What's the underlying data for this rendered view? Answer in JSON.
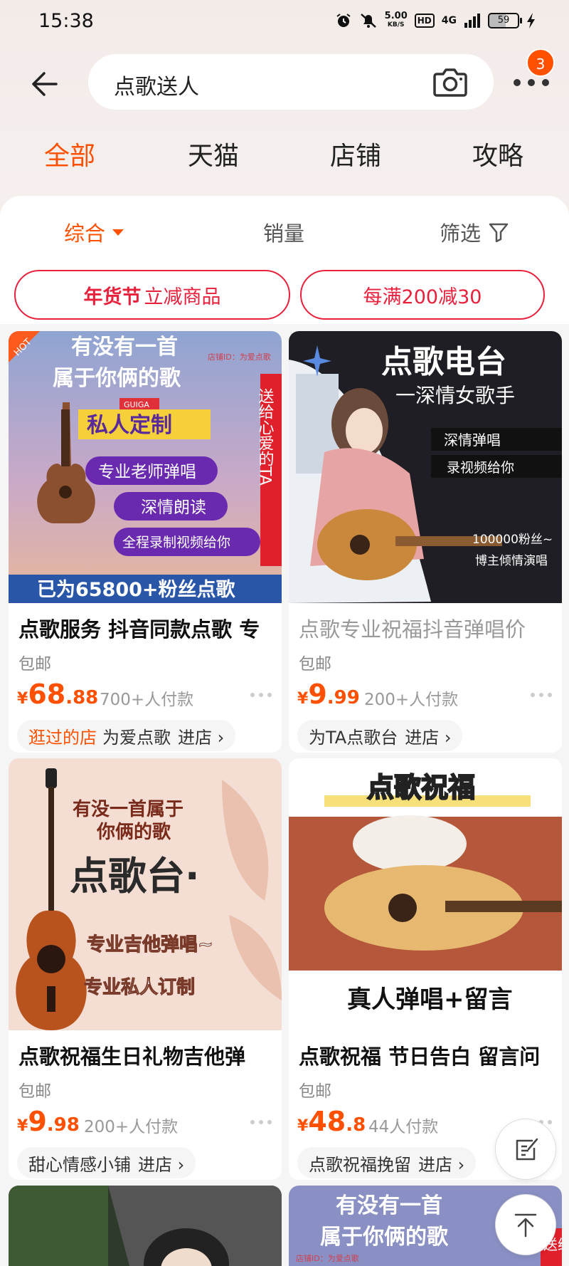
{
  "status_bar": {
    "time": "15:38",
    "net_speed_top": "5.00",
    "net_speed_bottom": "KB/S",
    "hd": "HD",
    "signal": "4G",
    "battery": "59"
  },
  "search": {
    "query": "点歌送人",
    "message_count": "3"
  },
  "top_tabs": [
    {
      "label": "全部",
      "active": true
    },
    {
      "label": "天猫"
    },
    {
      "label": "店铺"
    },
    {
      "label": "攻略"
    }
  ],
  "sort": {
    "overall": "综合",
    "sales": "销量",
    "filter": "筛选"
  },
  "promos": {
    "left_strong": "年货节",
    "left_text": "立减商品",
    "right_text": "每满200减30"
  },
  "products": [
    {
      "title": "点歌服务 抖音同款点歌 专",
      "shipping": "包邮",
      "price_yen": "¥",
      "price_int": "68",
      "price_dec": ".88",
      "sales": "700+人付款",
      "shop_visited": "逛过的店",
      "shop_name": "为爱点歌",
      "shop_enter": "进店 ›",
      "image": {
        "hot": "HOT",
        "line1": "有没有一首",
        "line2": "属于你俩的歌",
        "brand": "GUIGA",
        "custom": "私人定制",
        "tag1": "专业老师弹唱",
        "tag2": "深情朗读",
        "tag3": "全程录制视频给你",
        "side_text": "送给心爱的TA",
        "bottom": "已为65800+粉丝点歌",
        "watermark": "店铺ID：为爱点歌"
      }
    },
    {
      "title": "点歌专业祝福抖音弹唱价",
      "shipping": "包邮",
      "price_yen": "¥",
      "price_int": "9",
      "price_dec": ".99",
      "sales": "200+人付款",
      "shop_name": "为TA点歌台",
      "shop_enter": "进店 ›",
      "image": {
        "title1": "点歌电台",
        "title2": "一深情女歌手",
        "tag1": "深情弹唱",
        "tag2": "录视频给你",
        "fans": "100000粉丝~",
        "note": "博主倾情演唱"
      }
    },
    {
      "title": "点歌祝福生日礼物吉他弹",
      "shipping": "包邮",
      "price_yen": "¥",
      "price_int": "9",
      "price_dec": ".98",
      "sales": "200+人付款",
      "shop_name": "甜心情感小铺",
      "shop_enter": "进店 ›",
      "image": {
        "line1": "有没一首属于",
        "line2": "你俩的歌",
        "title": "点歌台·",
        "tag1": "专业吉他弹唱~",
        "tag2": "专业私人订制"
      }
    },
    {
      "title": "点歌祝福 节日告白 留言问",
      "shipping": "包邮",
      "price_yen": "¥",
      "price_int": "48",
      "price_dec": ".8",
      "sales": "44人付款",
      "shop_name": "点歌祝福挽留",
      "shop_enter": "进店 ›",
      "image": {
        "title": "点歌祝福",
        "bottom": "真人弹唱+留言"
      }
    },
    {
      "image": {}
    },
    {
      "image": {
        "line1": "有没有一首",
        "line2": "属于你俩的歌",
        "watermark": "店铺ID：为爱点歌",
        "side": "送给"
      }
    }
  ],
  "colors": {
    "accent": "#ff5000",
    "promo_red": "#e8203c"
  }
}
